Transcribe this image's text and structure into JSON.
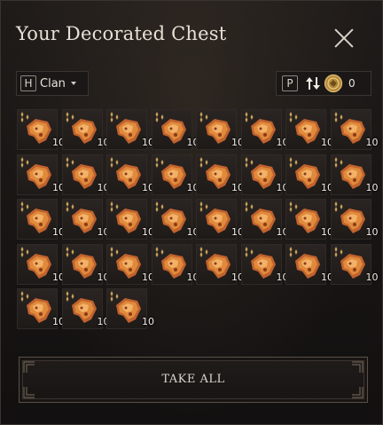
{
  "window": {
    "title": "Your Decorated Chest"
  },
  "filter": {
    "hotkey": "H",
    "label": "Clan"
  },
  "sort": {
    "hotkey": "P",
    "sort_icon": "sort-arrows-icon",
    "currency_icon": "gold-coin-icon",
    "currency_value": "0"
  },
  "items": [
    {
      "qty": "10"
    },
    {
      "qty": "10"
    },
    {
      "qty": "10"
    },
    {
      "qty": "10"
    },
    {
      "qty": "10"
    },
    {
      "qty": "10"
    },
    {
      "qty": "10"
    },
    {
      "qty": "10"
    },
    {
      "qty": "10"
    },
    {
      "qty": "10"
    },
    {
      "qty": "10"
    },
    {
      "qty": "10"
    },
    {
      "qty": "10"
    },
    {
      "qty": "10"
    },
    {
      "qty": "10"
    },
    {
      "qty": "10"
    },
    {
      "qty": "10"
    },
    {
      "qty": "10"
    },
    {
      "qty": "10"
    },
    {
      "qty": "10"
    },
    {
      "qty": "10"
    },
    {
      "qty": "10"
    },
    {
      "qty": "10"
    },
    {
      "qty": "10"
    },
    {
      "qty": "10"
    },
    {
      "qty": "10"
    },
    {
      "qty": "10"
    },
    {
      "qty": "10"
    },
    {
      "qty": "10"
    },
    {
      "qty": "10"
    },
    {
      "qty": "10"
    },
    {
      "qty": "10"
    },
    {
      "qty": "10"
    },
    {
      "qty": "10"
    },
    {
      "qty": "10"
    }
  ],
  "actions": {
    "take_all": "TAKE ALL"
  },
  "colors": {
    "accent": "#e08a3c",
    "text": "#e6e0d6",
    "background": "#171413"
  }
}
